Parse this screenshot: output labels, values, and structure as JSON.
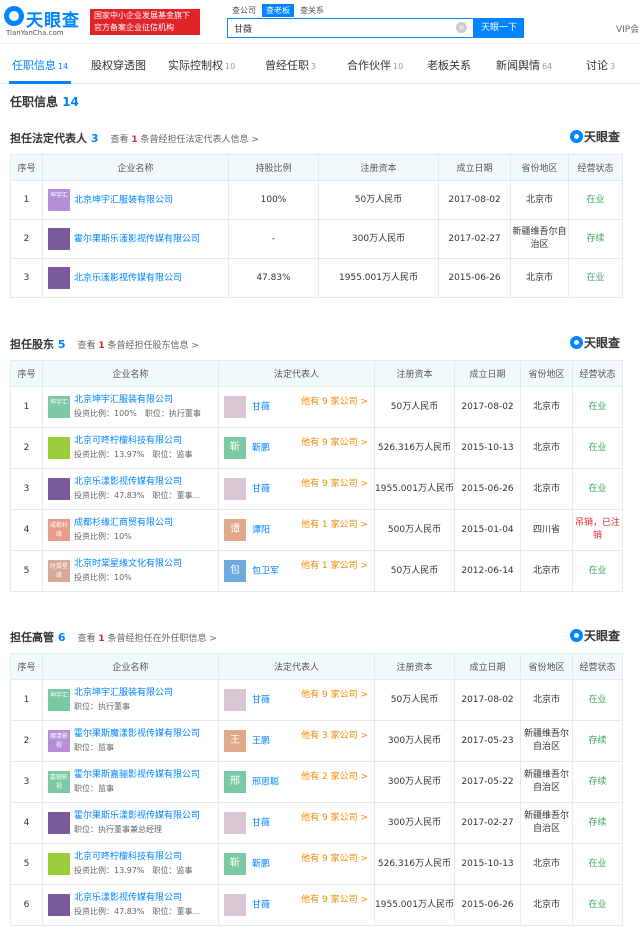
{
  "header": {
    "logo_name": "天眼查",
    "logo_sub": "TianYanCha.com",
    "badge_line1": "国家中小企业发展基金旗下",
    "badge_line2": "官方备案企业征信机构",
    "search_tabs": [
      "查公司",
      "查老板",
      "查关系"
    ],
    "search_value": "甘薇",
    "search_clear": "×",
    "search_button": "天眼一下",
    "vip": "VIP会"
  },
  "nav": [
    {
      "label": "任职信息",
      "count": "14"
    },
    {
      "label": "股权穿透图",
      "count": ""
    },
    {
      "label": "实际控制权",
      "count": "10"
    },
    {
      "label": "曾经任职",
      "count": "3"
    },
    {
      "label": "合作伙伴",
      "count": "10"
    },
    {
      "label": "老板关系",
      "count": ""
    },
    {
      "label": "新闻舆情",
      "count": "64"
    },
    {
      "label": "讨论",
      "count": "3"
    }
  ],
  "section_title": {
    "label": "任职信息",
    "count": "14"
  },
  "watermark": "天眼查",
  "colors": {
    "accent": "#0084ff",
    "brand_red": "#e2232a",
    "status_green": "#3ca55c",
    "more_orange": "#f08a00"
  },
  "legal": {
    "title": "担任法定代表人",
    "count": "3",
    "past_pre": "查看",
    "past_num": "1",
    "past_post": "条曾经担任法定代表人信息 >",
    "headers": [
      "序号",
      "企业名称",
      "持股比例",
      "注册资本",
      "成立日期",
      "省份地区",
      "经营状态"
    ],
    "rows": [
      {
        "no": "1",
        "logo": "坤宇汇",
        "logo_color": "#b58fd6",
        "company": "北京坤宇汇服装有限公司",
        "share": "100%",
        "capital": "50万人民币",
        "date": "2017-08-02",
        "region": "北京市",
        "status": "在业"
      },
      {
        "no": "2",
        "logo": "",
        "logo_color": "#7a5a9a",
        "company": "霍尔果斯乐漾影视传媒有限公司",
        "share": "-",
        "capital": "300万人民币",
        "date": "2017-02-27",
        "region": "新疆维吾尔自治区",
        "status": "存续"
      },
      {
        "no": "3",
        "logo": "",
        "logo_color": "#7a5a9a",
        "company": "北京乐漾影视传媒有限公司",
        "share": "47.83%",
        "capital": "1955.001万人民币",
        "date": "2015-06-26",
        "region": "北京市",
        "status": "在业"
      }
    ]
  },
  "shareholder": {
    "title": "担任股东",
    "count": "5",
    "past_pre": "查看",
    "past_num": "1",
    "past_post": "条曾经担任股东信息 >",
    "headers": [
      "序号",
      "企业名称",
      "法定代表人",
      "注册资本",
      "成立日期",
      "省份地区",
      "经营状态"
    ],
    "rows": [
      {
        "no": "1",
        "logo": "坤宇汇",
        "logo_color": "#7bc8a4",
        "company": "北京坤宇汇服装有限公司",
        "info": "投资比例：100%　职位：执行董事",
        "av": "",
        "av_color": "#d9c7d4",
        "person": "甘薇",
        "more": "他有 9 家公司 >",
        "capital": "50万人民币",
        "date": "2017-08-02",
        "region": "北京市",
        "status": "在业"
      },
      {
        "no": "2",
        "logo": "",
        "logo_color": "#9ccc3c",
        "company": "北京可咚柠檬科技有限公司",
        "info": "投资比例：13.97%　职位：监事",
        "av": "靳",
        "av_color": "#7bc8a4",
        "person": "靳鹏",
        "more": "他有 9 家公司 >",
        "capital": "526.316万人民币",
        "date": "2015-10-13",
        "region": "北京市",
        "status": "在业"
      },
      {
        "no": "3",
        "logo": "",
        "logo_color": "#7a5a9a",
        "company": "北京乐漾影视传媒有限公司",
        "info": "投资比例：47.83%　职位：董事...",
        "av": "",
        "av_color": "#d9c7d4",
        "person": "甘薇",
        "more": "他有 9 家公司 >",
        "capital": "1955.001万人民币",
        "date": "2015-06-26",
        "region": "北京市",
        "status": "在业"
      },
      {
        "no": "4",
        "logo": "成都杉缘",
        "logo_color": "#e89b8c",
        "company": "成都杉缘汇商贸有限公司",
        "info": "投资比例：10%",
        "av": "谭",
        "av_color": "#e0a98a",
        "person": "谭阳",
        "more": "他有 1 家公司 >",
        "capital": "500万人民币",
        "date": "2015-01-04",
        "region": "四川省",
        "status": "吊销，已注销",
        "status_red": true
      },
      {
        "no": "5",
        "logo": "时棠星缘",
        "logo_color": "#d8a898",
        "company": "北京时棠星缘文化有限公司",
        "info": "投资比例：10%",
        "av": "包",
        "av_color": "#6fa8dc",
        "person": "包卫军",
        "more": "他有 1 家公司 >",
        "capital": "50万人民币",
        "date": "2012-06-14",
        "region": "北京市",
        "status": "在业"
      }
    ]
  },
  "executive": {
    "title": "担任高管",
    "count": "6",
    "past_pre": "查看",
    "past_num": "1",
    "past_post": "条曾经担任在外任职信息 >",
    "headers": [
      "序号",
      "企业名称",
      "法定代表人",
      "注册资本",
      "成立日期",
      "省份地区",
      "经营状态"
    ],
    "rows": [
      {
        "no": "1",
        "logo": "坤宇汇",
        "logo_color": "#7bc8a4",
        "company": "北京坤宇汇服装有限公司",
        "info": "职位：执行董事",
        "av": "",
        "av_color": "#d9c7d4",
        "person": "甘薇",
        "more": "他有 9 家公司 >",
        "capital": "50万人民币",
        "date": "2017-08-02",
        "region": "北京市",
        "status": "在业"
      },
      {
        "no": "2",
        "logo": "魔漾影视",
        "logo_color": "#b58fd6",
        "company": "霍尔果斯魔漾影视传媒有限公司",
        "info": "职位：监事",
        "av": "王",
        "av_color": "#e0a98a",
        "person": "王鹏",
        "more": "他有 3 家公司 >",
        "capital": "300万人民币",
        "date": "2017-05-23",
        "region": "新疆维吾尔自治区",
        "status": "存续"
      },
      {
        "no": "3",
        "logo": "嘉骊影视",
        "logo_color": "#7bc8a4",
        "company": "霍尔果斯嘉骊影视传媒有限公司",
        "info": "职位：监事",
        "av": "邢",
        "av_color": "#7bc8a4",
        "person": "邢思聪",
        "more": "他有 2 家公司 >",
        "capital": "300万人民币",
        "date": "2017-05-22",
        "region": "新疆维吾尔自治区",
        "status": "存续"
      },
      {
        "no": "4",
        "logo": "",
        "logo_color": "#7a5a9a",
        "company": "霍尔果斯乐漾影视传媒有限公司",
        "info": "职位：执行董事兼总经理",
        "av": "",
        "av_color": "#d9c7d4",
        "person": "甘薇",
        "more": "他有 9 家公司 >",
        "capital": "300万人民币",
        "date": "2017-02-27",
        "region": "新疆维吾尔自治区",
        "status": "存续"
      },
      {
        "no": "5",
        "logo": "",
        "logo_color": "#9ccc3c",
        "company": "北京可咚柠檬科技有限公司",
        "info": "投资比例：13.97%　职位：监事",
        "av": "靳",
        "av_color": "#7bc8a4",
        "person": "靳鹏",
        "more": "他有 9 家公司 >",
        "capital": "526.316万人民币",
        "date": "2015-10-13",
        "region": "北京市",
        "status": "在业"
      },
      {
        "no": "6",
        "logo": "",
        "logo_color": "#7a5a9a",
        "company": "北京乐漾影视传媒有限公司",
        "info": "投资比例：47.83%　职位：董事...",
        "av": "",
        "av_color": "#d9c7d4",
        "person": "甘薇",
        "more": "他有 9 家公司 >",
        "capital": "1955.001万人民币",
        "date": "2015-06-26",
        "region": "北京市",
        "status": "在业"
      }
    ]
  }
}
